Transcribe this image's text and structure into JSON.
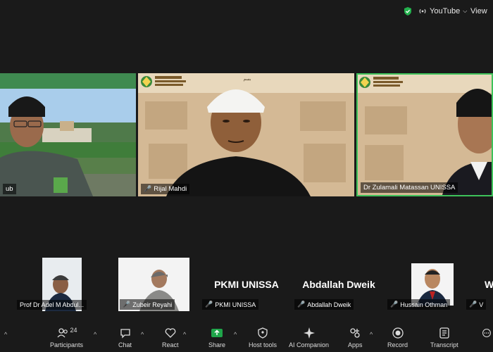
{
  "topbar": {
    "stream_label": "YouTube",
    "view_label": "View"
  },
  "main_tiles": [
    {
      "name": "ub"
    },
    {
      "name": "Rijal Mahdi"
    },
    {
      "name": "Dr Zulamali Matassan UNISSA"
    }
  ],
  "banner": {
    "line1": "FORUM ANTARABANGSA MANUSKRIP ISLAM",
    "line2": "TEMA: KHAZANAH PERBENDAHARAAN DAN ISLAMISASI ILMU"
  },
  "strip": [
    {
      "name": "Prof Dr Adel M Abdul...",
      "label": ""
    },
    {
      "name": "Zubeir Reyahi",
      "label": ""
    },
    {
      "name": "PKMI UNISSA",
      "label": "PKMI UNISSA"
    },
    {
      "name": "Abdallah Dweik",
      "label": "Abdallah Dweik"
    },
    {
      "name": "Hussain Othman",
      "label": ""
    },
    {
      "name": "V",
      "label": "W"
    }
  ],
  "toolbar": {
    "participants": "Participants",
    "participants_count": "24",
    "chat": "Chat",
    "react": "React",
    "share": "Share",
    "host_tools": "Host tools",
    "ai_companion": "AI Companion",
    "apps": "Apps",
    "record": "Record",
    "transcript": "Transcript"
  },
  "colors": {
    "active_speaker": "#3ec25a",
    "mic_off": "#e23a3a",
    "share_green": "#1fa54a"
  }
}
